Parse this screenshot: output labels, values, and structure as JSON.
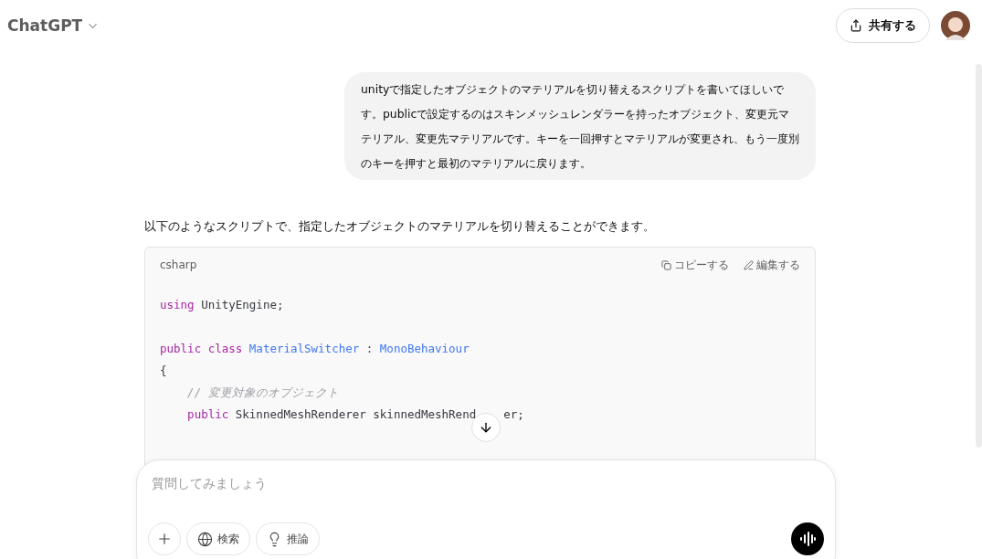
{
  "header": {
    "title": "ChatGPT",
    "share_label": "共有する"
  },
  "user_message": "unityで指定したオブジェクトのマテリアルを切り替えるスクリプトを書いてほしいです。publicで設定するのはスキンメッシュレンダラーを持ったオブジェクト、変更元マテリアル、変更先マテリアルです。キーを一回押すとマテリアルが変更され、もう一度別のキーを押すと最初のマテリアルに戻ります。",
  "assistant_intro": "以下のようなスクリプトで、指定したオブジェクトのマテリアルを切り替えることができます。",
  "code_block": {
    "language": "csharp",
    "copy_label": "コピーする",
    "edit_label": "編集する",
    "lines": [
      {
        "kind": "code",
        "tokens": [
          {
            "kind": "keyword",
            "text": "using"
          },
          {
            "kind": "plain",
            "text": " UnityEngine;"
          }
        ]
      },
      {
        "kind": "blank"
      },
      {
        "kind": "code",
        "tokens": [
          {
            "kind": "keyword",
            "text": "public class"
          },
          {
            "kind": "type",
            "text": " MaterialSwitcher"
          },
          {
            "kind": "plain",
            "text": " : "
          },
          {
            "kind": "type",
            "text": "MonoBehaviour"
          }
        ]
      },
      {
        "kind": "code",
        "tokens": [
          {
            "kind": "plain",
            "text": "{"
          }
        ]
      },
      {
        "kind": "code",
        "tokens": [
          {
            "kind": "comment",
            "text": "    // 変更対象のオブジェクト"
          }
        ]
      },
      {
        "kind": "code",
        "tokens": [
          {
            "kind": "keyword",
            "text": "    public"
          },
          {
            "kind": "plain",
            "text": " SkinnedMeshRenderer skinnedMeshRend"
          },
          {
            "kind": "covered"
          },
          {
            "kind": "plain",
            "text": "er;"
          }
        ]
      }
    ]
  },
  "composer": {
    "placeholder": "質問してみましょう",
    "tools": [
      {
        "kind": "plus"
      },
      {
        "kind": "globe",
        "label": "検索"
      },
      {
        "kind": "bulb",
        "label": "推論"
      }
    ]
  }
}
